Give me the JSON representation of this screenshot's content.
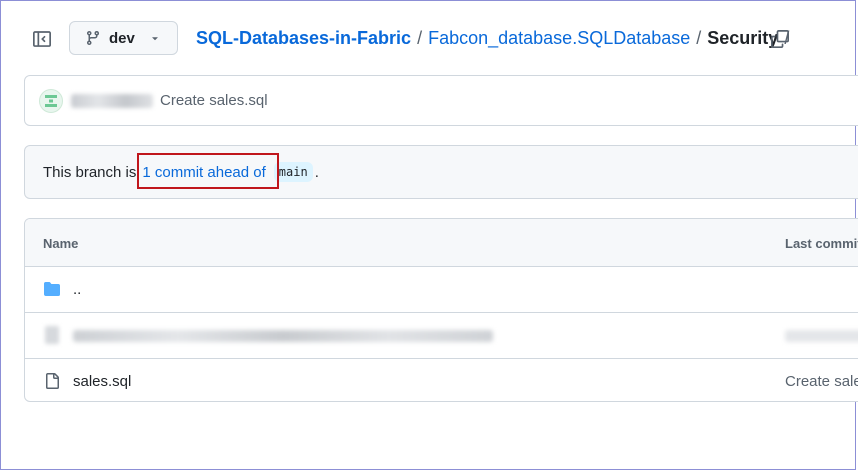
{
  "topbar": {
    "branch": {
      "name": "dev",
      "icon": "git-branch-icon"
    },
    "breadcrumb": {
      "repo": "SQL-Databases-in-Fabric",
      "sep1": "/",
      "folder": "Fabcon_database.SQLDatabase",
      "sep2": "/",
      "current": "Security",
      "sep3": "/"
    }
  },
  "commit": {
    "author": "[blurred]",
    "message": "Create sales.sql"
  },
  "ahead_banner": {
    "prefix": "This branch is",
    "link": "1 commit ahead of",
    "base_branch": "main",
    "suffix": "."
  },
  "files": {
    "columns": {
      "name": "Name",
      "last_commit": "Last commit"
    },
    "rows": [
      {
        "name": "..",
        "icon": "folder-icon",
        "commit": ""
      },
      {
        "name": "[blurred]",
        "icon": "file-icon",
        "commit": "[blurred]"
      },
      {
        "name": "sales.sql",
        "icon": "file-icon",
        "commit": "Create sales.sql"
      }
    ]
  },
  "colors": {
    "link": "#0969da",
    "highlight": "#c0161c",
    "folder": "#54aeff"
  }
}
